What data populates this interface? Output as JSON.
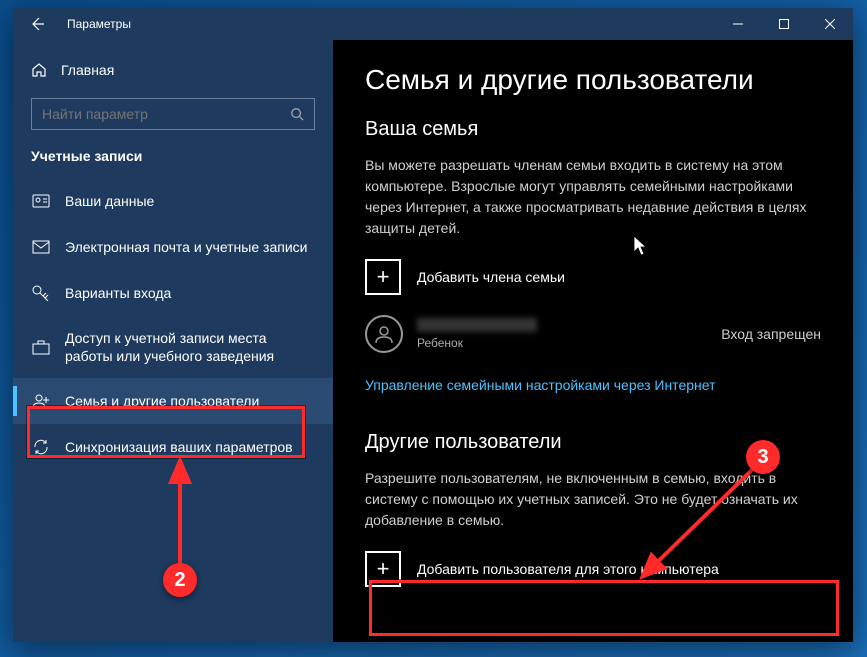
{
  "window": {
    "title": "Параметры"
  },
  "sidebar": {
    "home": "Главная",
    "search_placeholder": "Найти параметр",
    "section": "Учетные записи",
    "items": [
      {
        "label": "Ваши данные"
      },
      {
        "label": "Электронная почта и учетные записи"
      },
      {
        "label": "Варианты входа"
      },
      {
        "label": "Доступ к учетной записи места работы или учебного заведения"
      },
      {
        "label": "Семья и другие пользователи"
      },
      {
        "label": "Синхронизация ваших параметров"
      }
    ]
  },
  "main": {
    "heading": "Семья и другие пользователи",
    "family_title": "Ваша семья",
    "family_desc": "Вы можете разрешать членам семьи входить в систему на этом компьютере. Взрослые могут управлять семейными настройками через Интернет, а также просматривать недавние действия в целях защиты детей.",
    "add_family": "Добавить члена семьи",
    "member_type": "Ребенок",
    "member_status": "Вход запрещен",
    "family_link": "Управление семейными настройками через Интернет",
    "others_title": "Другие пользователи",
    "others_desc": "Разрешите пользователям, не включенным в семью, входить в систему с помощью их учетных записей. Это не будет означать их добавление в семью.",
    "add_other": "Добавить пользователя для этого компьютера"
  },
  "annotations": {
    "badge2": "2",
    "badge3": "3"
  }
}
